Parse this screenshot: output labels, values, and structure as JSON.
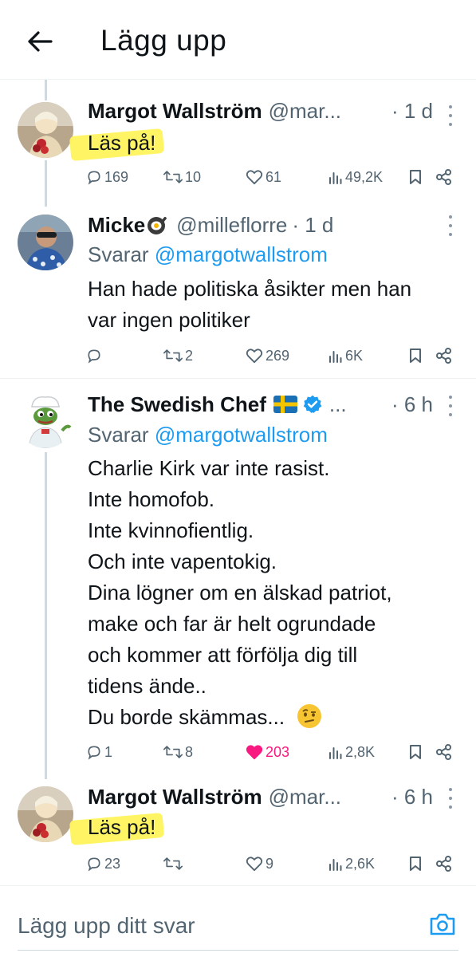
{
  "header": {
    "title": "Lägg upp"
  },
  "tweets": [
    {
      "name": "Margot Wallström",
      "handle": "@mar...",
      "time": "· 1 d",
      "text": "Läs på!",
      "stats": {
        "replies": "169",
        "retweets": "10",
        "likes": "61",
        "views": "49,2K"
      }
    },
    {
      "name": "Micke",
      "handle": "@milleflorre",
      "time": "· 1 d",
      "reply_prefix": "Svarar",
      "reply_mention": "@margotwallstrom",
      "text_lines": [
        "Han hade politiska åsikter men han",
        "var ingen politiker"
      ],
      "stats": {
        "replies": "",
        "retweets": "2",
        "likes": "269",
        "views": "6K"
      }
    },
    {
      "name": "The Swedish Chef",
      "handle": "...",
      "time": "· 6 h",
      "reply_prefix": "Svarar",
      "reply_mention": "@margotwallstrom",
      "text_lines": [
        "Charlie Kirk var inte rasist.",
        "Inte homofob.",
        "Inte kvinnofientlig.",
        "Och inte vapentokig.",
        "Dina lögner om en älskad patriot,",
        "make och far är helt ogrundade",
        "och kommer att förfölja dig till",
        "tidens ände..",
        "Du borde skämmas..."
      ],
      "stats": {
        "replies": "1",
        "retweets": "8",
        "likes": "203",
        "views": "2,8K"
      }
    },
    {
      "name": "Margot Wallström",
      "handle": "@mar...",
      "time": "· 6 h",
      "text": "Läs på!",
      "stats": {
        "replies": "23",
        "retweets": "",
        "likes": "9",
        "views": "2,6K"
      }
    }
  ],
  "reply_box": {
    "placeholder": "Lägg upp ditt svar"
  },
  "colors": {
    "accent": "#1d9bf0",
    "like": "#f91880",
    "highlight": "#fff45c",
    "muted": "#536471"
  },
  "icons": [
    "back-arrow-icon",
    "more-icon",
    "reply-icon",
    "retweet-icon",
    "heart-icon",
    "views-icon",
    "bookmark-icon",
    "share-icon",
    "verified-icon",
    "sweden-flag-icon",
    "frying-pan-icon",
    "camera-icon",
    "raised-eyebrow-emoji"
  ]
}
